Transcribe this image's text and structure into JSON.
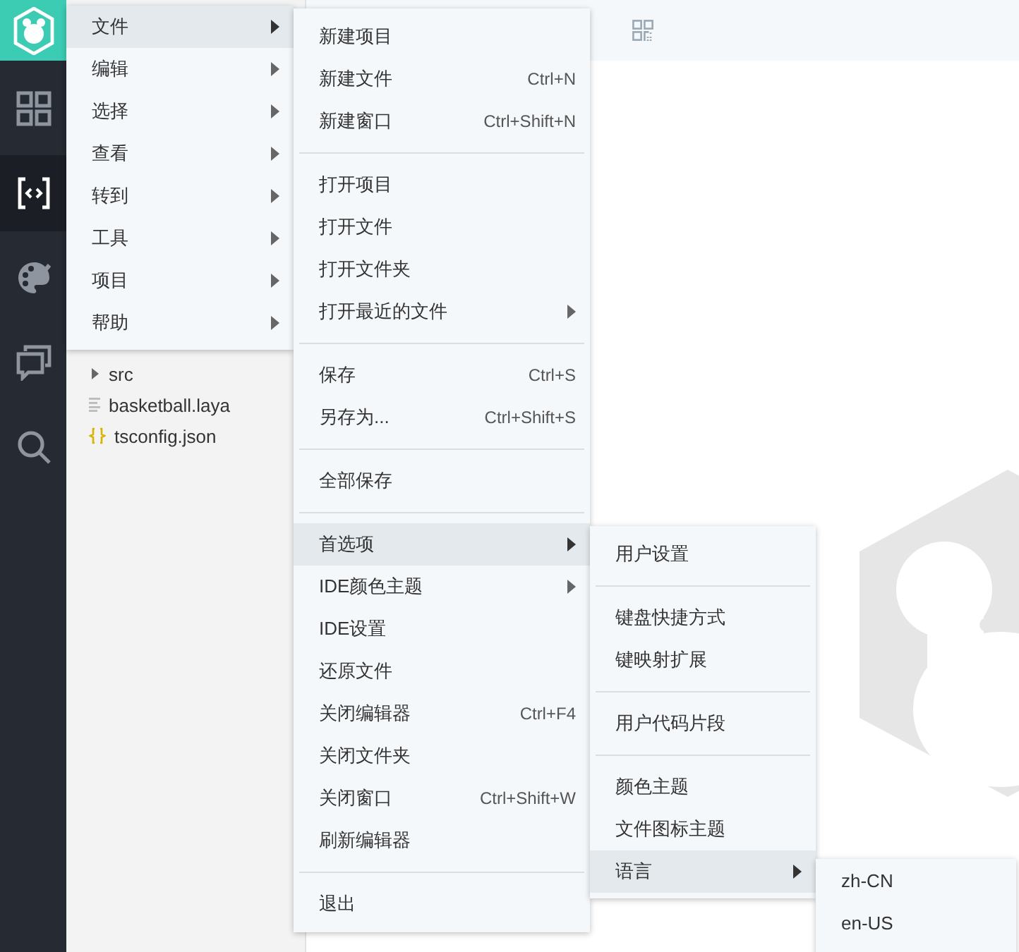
{
  "activity_bar": {
    "items": [
      {
        "selected": false
      },
      {
        "selected": true
      },
      {
        "selected": false
      },
      {
        "selected": false
      },
      {
        "selected": false
      }
    ]
  },
  "explorer": {
    "tree": [
      {
        "name": "src",
        "kind": "folder",
        "expanded": false
      },
      {
        "name": "basketball.laya",
        "kind": "file"
      },
      {
        "name": "tsconfig.json",
        "kind": "json"
      }
    ]
  },
  "menu_bar": {
    "items": [
      {
        "label": "文件",
        "selected": true
      },
      {
        "label": "编辑",
        "selected": false
      },
      {
        "label": "选择",
        "selected": false
      },
      {
        "label": "查看",
        "selected": false
      },
      {
        "label": "转到",
        "selected": false
      },
      {
        "label": "工具",
        "selected": false
      },
      {
        "label": "项目",
        "selected": false
      },
      {
        "label": "帮助",
        "selected": false
      }
    ]
  },
  "file_menu": {
    "groups": [
      {
        "items": [
          {
            "label": "新建项目",
            "submenu": false,
            "selected": false
          },
          {
            "label": "新建文件",
            "shortcut": "Ctrl+N",
            "submenu": false,
            "selected": false
          },
          {
            "label": "新建窗口",
            "shortcut": "Ctrl+Shift+N",
            "submenu": false,
            "selected": false
          }
        ]
      },
      {
        "items": [
          {
            "label": "打开项目",
            "submenu": false,
            "selected": false
          },
          {
            "label": "打开文件",
            "submenu": false,
            "selected": false
          },
          {
            "label": "打开文件夹",
            "submenu": false,
            "selected": false
          },
          {
            "label": "打开最近的文件",
            "submenu": true,
            "selected": false
          }
        ]
      },
      {
        "items": [
          {
            "label": "保存",
            "shortcut": "Ctrl+S",
            "submenu": false,
            "selected": false
          },
          {
            "label": "另存为...",
            "shortcut": "Ctrl+Shift+S",
            "submenu": false,
            "selected": false
          }
        ]
      },
      {
        "items": [
          {
            "label": "全部保存",
            "submenu": false,
            "selected": false
          }
        ]
      },
      {
        "items": [
          {
            "label": "首选项",
            "submenu": true,
            "selected": true
          },
          {
            "label": "IDE颜色主题",
            "submenu": true,
            "selected": false
          },
          {
            "label": "IDE设置",
            "submenu": false,
            "selected": false
          },
          {
            "label": "还原文件",
            "submenu": false,
            "selected": false
          },
          {
            "label": "关闭编辑器",
            "shortcut": "Ctrl+F4",
            "submenu": false,
            "selected": false
          },
          {
            "label": "关闭文件夹",
            "submenu": false,
            "selected": false
          },
          {
            "label": "关闭窗口",
            "shortcut": "Ctrl+Shift+W",
            "submenu": false,
            "selected": false
          },
          {
            "label": "刷新编辑器",
            "submenu": false,
            "selected": false
          }
        ]
      },
      {
        "items": [
          {
            "label": "退出",
            "submenu": false,
            "selected": false
          }
        ]
      }
    ]
  },
  "preferences_menu": {
    "groups": [
      {
        "items": [
          {
            "label": "用户设置",
            "submenu": false,
            "selected": false
          }
        ]
      },
      {
        "items": [
          {
            "label": "键盘快捷方式",
            "submenu": false,
            "selected": false
          },
          {
            "label": "键映射扩展",
            "submenu": false,
            "selected": false
          }
        ]
      },
      {
        "items": [
          {
            "label": "用户代码片段",
            "submenu": false,
            "selected": false
          }
        ]
      },
      {
        "items": [
          {
            "label": "颜色主题",
            "submenu": false,
            "selected": false
          },
          {
            "label": "文件图标主题",
            "submenu": false,
            "selected": false
          },
          {
            "label": "语言",
            "submenu": true,
            "selected": true
          }
        ]
      }
    ]
  },
  "language_menu": {
    "groups": [
      {
        "items": [
          {
            "label": "zh-CN",
            "submenu": false,
            "selected": false
          },
          {
            "label": "en-US",
            "submenu": false,
            "selected": false
          }
        ]
      }
    ]
  }
}
